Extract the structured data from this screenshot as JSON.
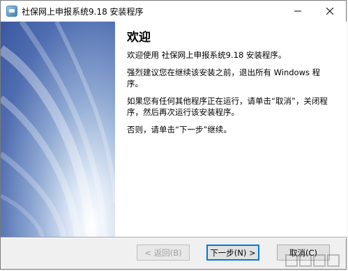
{
  "window": {
    "title": "社保网上申报系统9.18 安装程序",
    "icon": "installer-icon"
  },
  "content": {
    "heading": "欢迎",
    "paragraphs": [
      "欢迎使用 社保网上申报系统9.18 安装程序。",
      "强烈建议您在继续该安装之前，退出所有 Windows 程序。",
      "如果您有任何其他程序正在运行，请单击“取消”，关闭程序，然后再次运行该安装程序。",
      "否则，请单击“下一步”继续。"
    ]
  },
  "buttons": {
    "back": "< 返回(B)",
    "next": "下一步(N) >",
    "cancel": "取消(C)"
  },
  "colors": {
    "side_panel": "#4f6db0",
    "default_button_border": "#0078d7"
  }
}
